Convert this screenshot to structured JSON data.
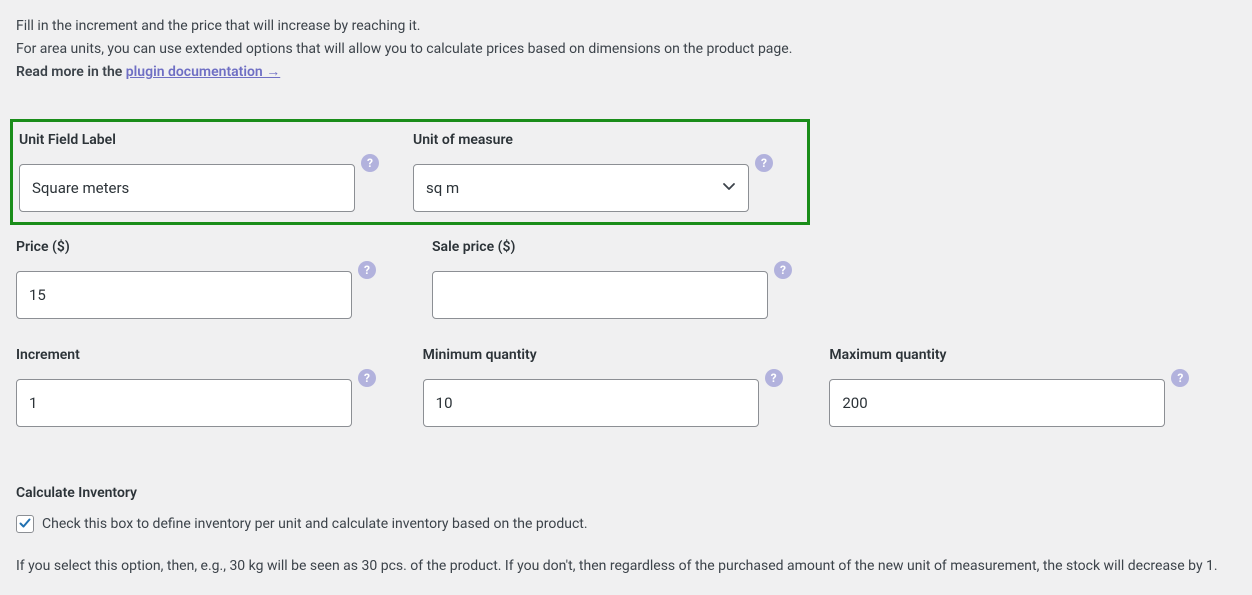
{
  "intro": {
    "line1": "Fill in the increment and the price that will increase by reaching it.",
    "line2": "For area units, you can use extended options that will allow you to calculate prices based on dimensions on the product page.",
    "line3_prefix": "Read more in the ",
    "link_text": "plugin documentation →"
  },
  "fields": {
    "unit_field_label": {
      "label": "Unit Field Label",
      "value": "Square meters"
    },
    "unit_of_measure": {
      "label": "Unit of measure",
      "value": "sq m"
    },
    "price": {
      "label": "Price ($)",
      "value": "15"
    },
    "sale_price": {
      "label": "Sale price ($)",
      "value": ""
    },
    "increment": {
      "label": "Increment",
      "value": "1"
    },
    "min_qty": {
      "label": "Minimum quantity",
      "value": "10"
    },
    "max_qty": {
      "label": "Maximum quantity",
      "value": "200"
    }
  },
  "inventory": {
    "heading": "Calculate Inventory",
    "checkbox_label": "Check this box to define inventory per unit and calculate inventory based on the product.",
    "checked": true,
    "help_text": "If you select this option, then, e.g., 30 kg will be seen as 30 pcs. of the product. If you don't, then regardless of the purchased amount of the new unit of measurement, the stock will decrease by 1."
  },
  "help_glyph": "?"
}
